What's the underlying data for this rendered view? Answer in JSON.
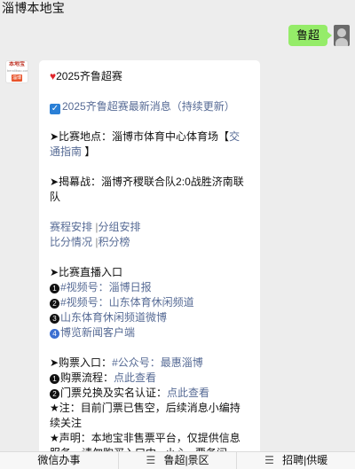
{
  "header": {
    "title": "淄博本地宝"
  },
  "user_message": {
    "text": "鲁超"
  },
  "bot_message": {
    "title_text": "2025齐鲁超赛",
    "latest_link": "2025齐鲁超赛最新消息（持续更新）",
    "venue_prefix": "➤比赛地点：淄博市体育中心体育场【",
    "venue_link": "交通指南",
    "venue_suffix": "】",
    "opening": "➤揭幕战：淄博齐稷联合队2:0战胜济南联队",
    "schedule_link": "赛程安排",
    "group_link": "分组安排",
    "score_link": "比分情况",
    "points_link": "积分榜",
    "live_heading": "➤比赛直播入口",
    "live_1_text": "#视频号：淄博日报",
    "live_2_text": "#视频号：山东体育休闲频道",
    "live_3_text": "山东体育休闲频道微博",
    "live_4_text": "博览新闻客户端",
    "ticket_prefix": "➤购票入口：",
    "ticket_link": "#公众号：最惠淄博",
    "flow_prefix": "购票流程：",
    "flow_link": "点此查看",
    "verify_prefix": "门票兑换及实名认证：",
    "verify_link": "点此查看",
    "note": "★注：目前门票已售空，后续消息小编持续关注",
    "statement": "★声明：本地宝非售票平台，仅提供信息服务，请勿购买入口中...小心...票务问"
  },
  "menu": {
    "items": [
      {
        "label": "微信办事"
      },
      {
        "label": "鲁超|景区"
      },
      {
        "label": "招聘|供暖"
      }
    ]
  },
  "colors": {
    "background": "#ededed",
    "user_bubble": "#95ec69",
    "link": "#576b95"
  }
}
